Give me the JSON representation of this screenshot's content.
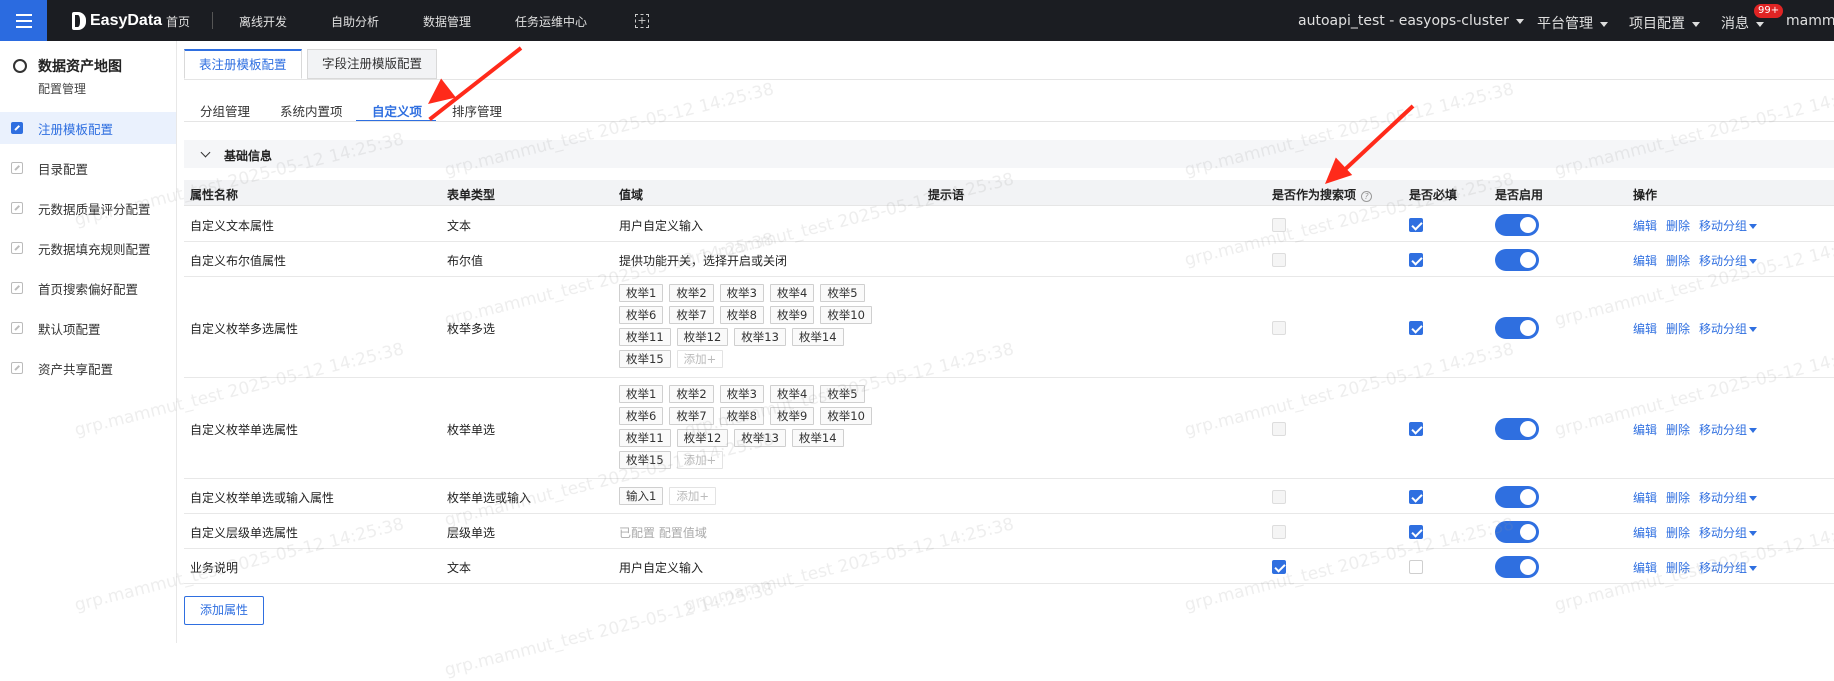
{
  "topbar": {
    "logo": "EasyData",
    "nav": [
      "首页",
      "离线开发",
      "自助分析",
      "数据管理",
      "任务运维中心"
    ],
    "cluster": "autoapi_test - easyops-cluster",
    "platform": "平台管理",
    "project": "项目配置",
    "messages": "消息",
    "badge": "99+",
    "user": "mammu"
  },
  "sidebar": {
    "title": "数据资产地图",
    "subtitle": "配置管理",
    "items": [
      "注册模板配置",
      "目录配置",
      "元数据质量评分配置",
      "元数据填充规则配置",
      "首页搜索偏好配置",
      "默认项配置",
      "资产共享配置"
    ]
  },
  "tabs": [
    "表注册模板配置",
    "字段注册模版配置"
  ],
  "subtabs": [
    "分组管理",
    "系统内置项",
    "自定义项",
    "排序管理"
  ],
  "section": "基础信息",
  "table": {
    "headers": [
      "属性名称",
      "表单类型",
      "值域",
      "提示语",
      "是否作为搜索项",
      "是否必填",
      "是否启用",
      "操作"
    ],
    "ops": [
      "编辑",
      "删除",
      "移动分组"
    ],
    "rows": [
      {
        "name": "自定义文本属性",
        "type": "文本",
        "domain": "用户自定义输入",
        "tags": [],
        "search": false,
        "required": true,
        "enabled": true
      },
      {
        "name": "自定义布尔值属性",
        "type": "布尔值",
        "domain": "提供功能开关，选择开启或关闭",
        "tags": [],
        "search": false,
        "required": true,
        "enabled": true
      },
      {
        "name": "自定义枚举多选属性",
        "type": "枚举多选",
        "domain": "",
        "tags": [
          "枚举1",
          "枚举2",
          "枚举3",
          "枚举4",
          "枚举5",
          "枚举6",
          "枚举7",
          "枚举8",
          "枚举9",
          "枚举10",
          "枚举11",
          "枚举12",
          "枚举13",
          "枚举14",
          "枚举15"
        ],
        "add": "添加+",
        "search": false,
        "required": true,
        "enabled": true
      },
      {
        "name": "自定义枚举单选属性",
        "type": "枚举单选",
        "domain": "",
        "tags": [
          "枚举1",
          "枚举2",
          "枚举3",
          "枚举4",
          "枚举5",
          "枚举6",
          "枚举7",
          "枚举8",
          "枚举9",
          "枚举10",
          "枚举11",
          "枚举12",
          "枚举13",
          "枚举14",
          "枚举15"
        ],
        "add": "添加+",
        "search": false,
        "required": true,
        "enabled": true
      },
      {
        "name": "自定义枚举单选或输入属性",
        "type": "枚举单选或输入",
        "domain": "",
        "tags": [
          "输入1"
        ],
        "add": "添加+",
        "search": false,
        "required": true,
        "enabled": true
      },
      {
        "name": "自定义层级单选属性",
        "type": "层级单选",
        "domain": "已配置  配置值域",
        "tags": [],
        "search": false,
        "required": true,
        "enabled": true
      },
      {
        "name": "业务说明",
        "type": "文本",
        "domain": "用户自定义输入",
        "tags": [],
        "search": true,
        "required": false,
        "enabled": true
      }
    ]
  },
  "add_attribute": "添加属性",
  "watermark": "grp.mammut_test 2025-05-12 14:25:38",
  "colors": {
    "accent": "#2f6fe0",
    "topbar": "#1b1d22",
    "arrow": "#ff2a1a"
  }
}
